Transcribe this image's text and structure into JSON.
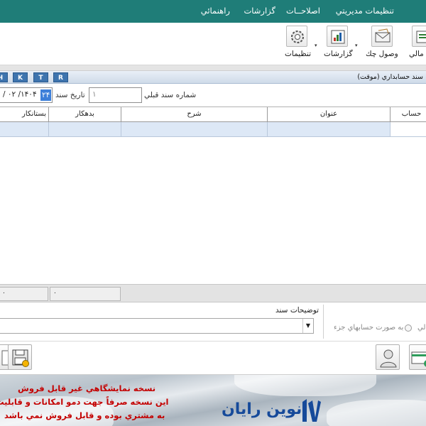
{
  "menu": {
    "items": [
      "تنظيمات مديريتي",
      "اصلاحــات",
      "گزارشات",
      "راهنمائي"
    ]
  },
  "toolbar": {
    "buttons": [
      {
        "label": "اسناد مالي",
        "icon": "financial-docs-icon"
      },
      {
        "label": "وصول چك",
        "icon": "check-receipt-icon"
      },
      {
        "label": "گزارشات",
        "icon": "reports-icon"
      },
      {
        "label": "تنظيمات",
        "icon": "settings-gear-icon"
      }
    ],
    "dropdown_glyph": "▾"
  },
  "form": {
    "title": "سند حسابداري (موقت)",
    "letter_buttons": [
      "R",
      "T",
      "K",
      "Ч"
    ]
  },
  "info": {
    "prev_doc_label": "شماره سند قبلي",
    "prev_doc_value": "۱",
    "date_label": "تاريخ سند",
    "date_day": "۲۴",
    "date_rest": "/ ۰۲ /۱۴۰۴"
  },
  "grid": {
    "columns": [
      "حساب",
      "عنوان",
      "شرح",
      "بدهكار",
      "بستانكار"
    ]
  },
  "totals": {
    "values": [
      "۰",
      "۰"
    ]
  },
  "description": {
    "title": "توضيحات سند",
    "radio_partial": "به صورت حسابهاي جزء",
    "radio_other": "مالي"
  },
  "banner": {
    "line1": "نسخه نمايشگاهي غير قابل فروش",
    "line2": "اين نسخه صرفاً جهت دمو امكانات و قابليت",
    "line3": "به مشتري بوده و قابل فروش نمي باشد",
    "brand": "نوين رايان"
  },
  "colors": {
    "menubar": "#1f7d78",
    "banner_text": "#c40000",
    "brand": "#164a9a",
    "grid_row": "#dde8f6"
  }
}
